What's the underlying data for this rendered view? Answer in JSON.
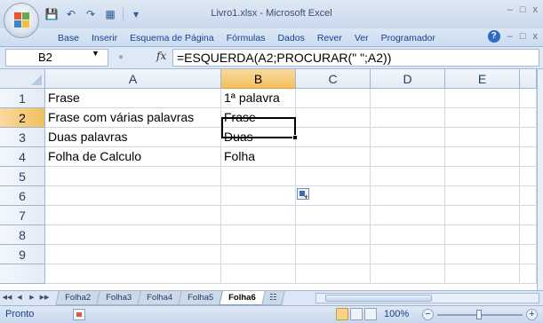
{
  "window": {
    "title": "Livro1.xlsx - Microsoft Excel",
    "controls": [
      "–",
      "□",
      "x"
    ]
  },
  "ribbon": {
    "tabs": [
      "Base",
      "Inserir",
      "Esquema de Página",
      "Fórmulas",
      "Dados",
      "Rever",
      "Ver",
      "Programador"
    ],
    "controls": [
      "–",
      "□",
      "x"
    ]
  },
  "formula_bar": {
    "name_box": "B2",
    "fx_label": "fx",
    "formula": "=ESQUERDA(A2;PROCURAR(\" \";A2))"
  },
  "sheet": {
    "columns": [
      "A",
      "B",
      "C",
      "D",
      "E"
    ],
    "selected_column": "B",
    "rows": [
      "1",
      "2",
      "3",
      "4",
      "5",
      "6",
      "7",
      "8",
      "9"
    ],
    "selected_row": "2",
    "cells": {
      "A1": "Frase",
      "B1": "1ª palavra",
      "A2": "Frase com várias palavras",
      "B2": "Frase",
      "A3": "Duas palavras",
      "B3": "Duas",
      "A4": "Folha de Calculo",
      "B4": "Folha"
    },
    "active_cell": "B2"
  },
  "sheet_tabs": {
    "tabs": [
      "Folha2",
      "Folha3",
      "Folha4",
      "Folha5",
      "Folha6"
    ],
    "active": "Folha6"
  },
  "status_bar": {
    "status": "Pronto",
    "zoom": "100%"
  }
}
